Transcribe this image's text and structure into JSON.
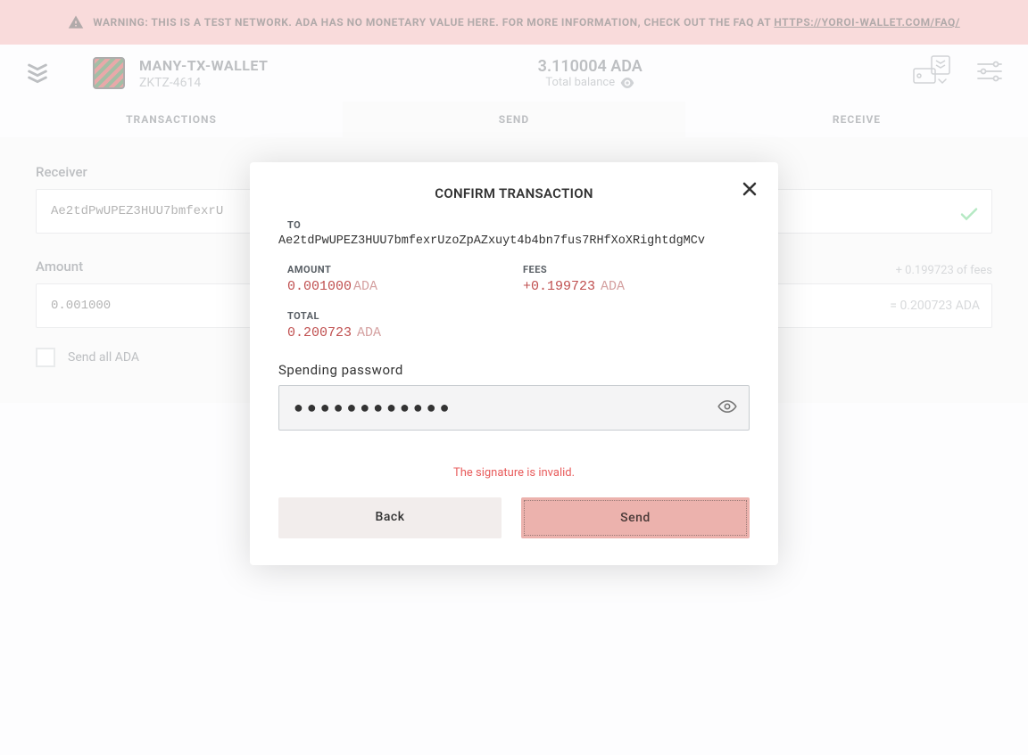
{
  "warning": {
    "prefix": "WARNING: THIS IS A TEST NETWORK. ADA HAS NO MONETARY VALUE HERE. FOR MORE INFORMATION, CHECK OUT THE FAQ AT ",
    "link_text": "HTTPS://YOROI-WALLET.COM/FAQ/"
  },
  "header": {
    "wallet_name": "MANY-TX-WALLET",
    "wallet_code": "ZKTZ-4614",
    "balance": "3.110004 ADA",
    "balance_label": "Total balance"
  },
  "tabs": {
    "transactions": "TRANSACTIONS",
    "send": "SEND",
    "receive": "RECEIVE"
  },
  "form": {
    "receiver_label": "Receiver",
    "receiver_value": "Ae2tdPwUPEZ3HUU7bmfexrU",
    "amount_label": "Amount",
    "amount_value": "0.001000",
    "fee_note": "+ 0.199723 of fees",
    "total_note": "= 0.200723 ADA",
    "send_all_label": "Send all ADA"
  },
  "modal": {
    "title": "CONFIRM TRANSACTION",
    "to_label": "TO",
    "to_value": "Ae2tdPwUPEZ3HUU7bmfexrUzoZpAZxuyt4b4bn7fus7RHfXoXRightdgMCv",
    "amount_label": "AMOUNT",
    "amount_num": "0.001000",
    "amount_cur": "ADA",
    "fees_label": "FEES",
    "fees_num": "+0.199723",
    "fees_cur": "ADA",
    "total_label": "TOTAL",
    "total_num": "0.200723",
    "total_cur": "ADA",
    "password_label": "Spending password",
    "password_value": "●●●●●●●●●●●●",
    "error": "The signature is invalid.",
    "back_btn": "Back",
    "send_btn": "Send"
  }
}
